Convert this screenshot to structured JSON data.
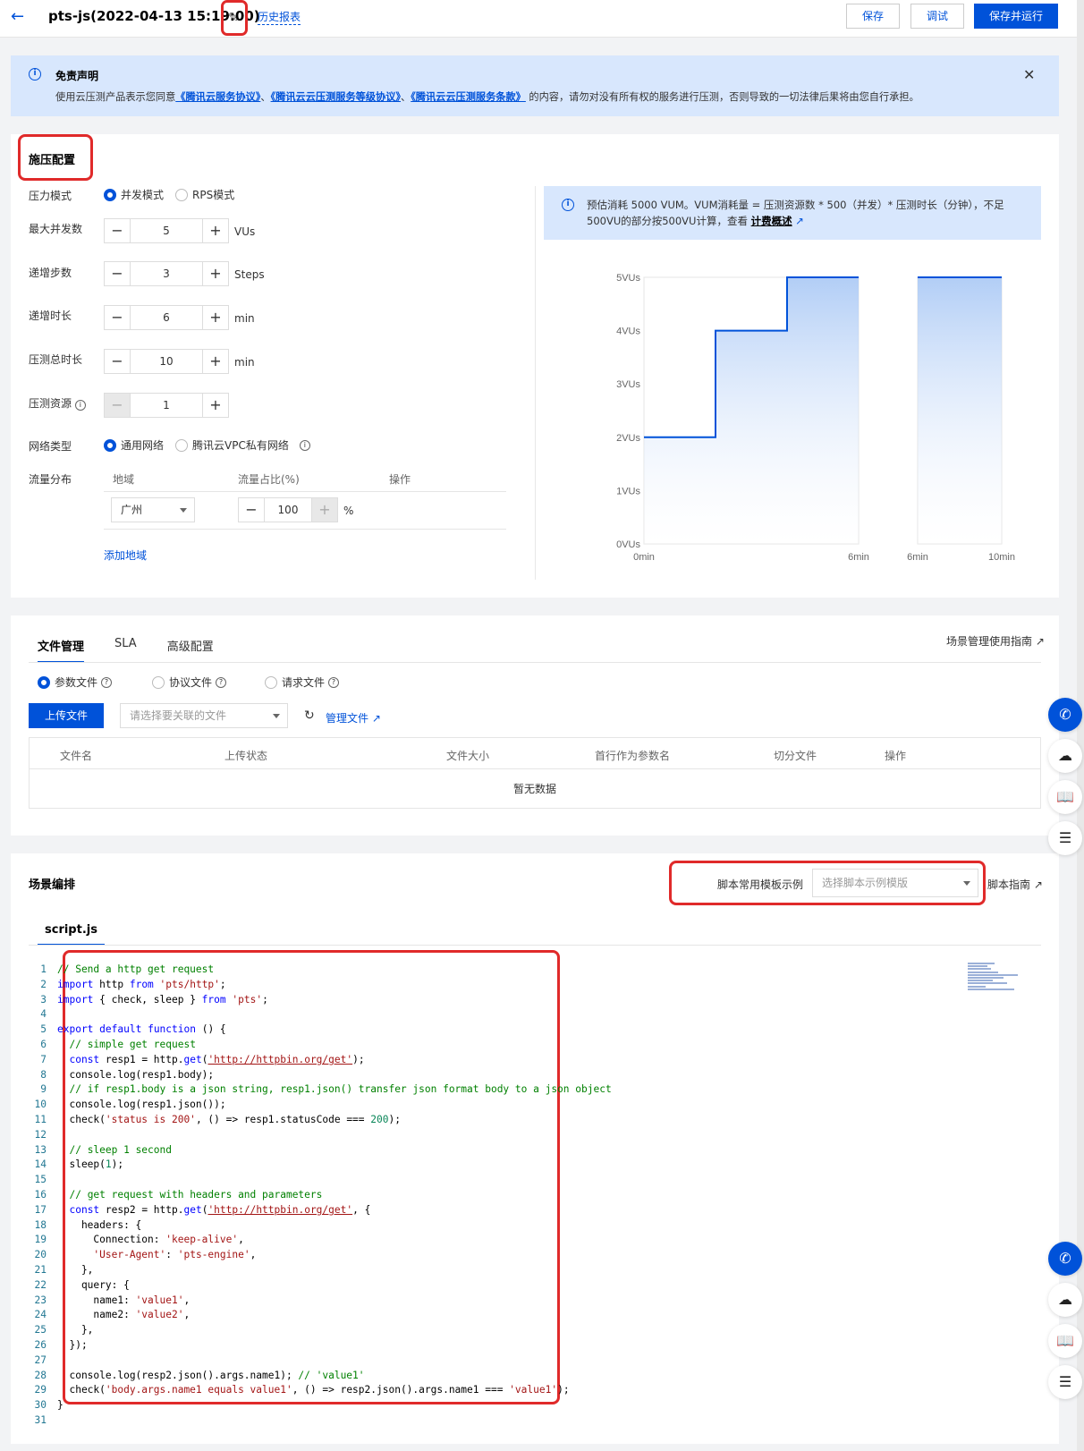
{
  "header": {
    "title": "pts-js(2022-04-13 15:19:00)",
    "history_link": "历史报表",
    "save": "保存",
    "debug": "调试",
    "save_run": "保存并运行"
  },
  "notice": {
    "title": "免责声明",
    "text_before": "使用云压测产品表示您同意",
    "link1": "《腾讯云服务协议》",
    "sep1": "、",
    "link2": "《腾讯云云压测服务等级协议》",
    "sep2": "、",
    "link3": "《腾讯云云压测服务条款》",
    "text_after": "的内容，请勿对没有所有权的服务进行压测，否则导致的一切法律后果将由您自行承担。"
  },
  "load_config": {
    "title": "施压配置",
    "mode_label": "压力模式",
    "mode_concurrent": "并发模式",
    "mode_rps": "RPS模式",
    "max_concurrency_label": "最大并发数",
    "max_concurrency_value": "5",
    "max_concurrency_unit": "VUs",
    "steps_label": "递增步数",
    "steps_value": "3",
    "steps_unit": "Steps",
    "ramp_label": "递增时长",
    "ramp_value": "6",
    "ramp_unit": "min",
    "total_label": "压测总时长",
    "total_value": "10",
    "total_unit": "min",
    "resource_label": "压测资源",
    "resource_value": "1",
    "network_label": "网络类型",
    "network_general": "通用网络",
    "network_vpc": "腾讯云VPC私有网络",
    "traffic_label": "流量分布",
    "col_region": "地域",
    "col_ratio": "流量占比(%)",
    "col_action": "操作",
    "region_value": "广州",
    "ratio_value": "100",
    "ratio_unit": "%",
    "add_region": "添加地域",
    "estimate_text": "预估消耗 5000 VUM。VUM消耗量 = 压测资源数 * 500（并发）* 压测时长（分钟），不足500VU的部分按500VU计算，查看",
    "estimate_link": "计费概述"
  },
  "chart_data": {
    "type": "line",
    "y_ticks": [
      "5VUs",
      "4VUs",
      "3VUs",
      "2VUs",
      "1VUs",
      "0VUs"
    ],
    "ylim": [
      0,
      5
    ],
    "panels": [
      {
        "x_ticks": [
          "0min",
          "6min"
        ],
        "xlim": [
          0,
          6
        ],
        "step_points": [
          [
            0,
            2
          ],
          [
            2,
            2
          ],
          [
            2,
            4
          ],
          [
            4,
            4
          ],
          [
            4,
            5
          ],
          [
            6,
            5
          ]
        ]
      },
      {
        "x_ticks": [
          "6min",
          "10min"
        ],
        "xlim": [
          6,
          10
        ],
        "step_points": [
          [
            6,
            5
          ],
          [
            10,
            5
          ]
        ]
      }
    ],
    "line_color": "#0052d9"
  },
  "file_mgmt": {
    "tabs": [
      "文件管理",
      "SLA",
      "高级配置"
    ],
    "guide_link": "场景管理使用指南",
    "file_types": [
      "参数文件",
      "协议文件",
      "请求文件"
    ],
    "upload_btn": "上传文件",
    "select_placeholder": "请选择要关联的文件",
    "manage_link": "管理文件",
    "columns": [
      "文件名",
      "上传状态",
      "文件大小",
      "首行作为参数名",
      "切分文件",
      "操作"
    ],
    "empty": "暂无数据"
  },
  "scenario": {
    "title": "场景编排",
    "template_label": "脚本常用模板示例",
    "template_placeholder": "选择脚本示例模版",
    "script_guide": "脚本指南",
    "file_tab": "script.js"
  },
  "code_lines": [
    "// Send a http get request",
    "import http from 'pts/http';",
    "import { check, sleep } from 'pts';",
    "",
    "export default function () {",
    "  // simple get request",
    "  const resp1 = http.get('http://httpbin.org/get');",
    "  console.log(resp1.body);",
    "  // if resp1.body is a json string, resp1.json() transfer json format body to a json object",
    "  console.log(resp1.json());",
    "  check('status is 200', () => resp1.statusCode === 200);",
    "",
    "  // sleep 1 second",
    "  sleep(1);",
    "",
    "  // get request with headers and parameters",
    "  const resp2 = http.get('http://httpbin.org/get', {",
    "    headers: {",
    "      Connection: 'keep-alive',",
    "      'User-Agent': 'pts-engine',",
    "    },",
    "    query: {",
    "      name1: 'value1',",
    "      name2: 'value2',",
    "    },",
    "  });",
    "",
    "  console.log(resp2.json().args.name1); // 'value1'",
    "  check('body.args.name1 equals value1', () => resp2.json().args.name1 === 'value1');",
    "}",
    ""
  ]
}
